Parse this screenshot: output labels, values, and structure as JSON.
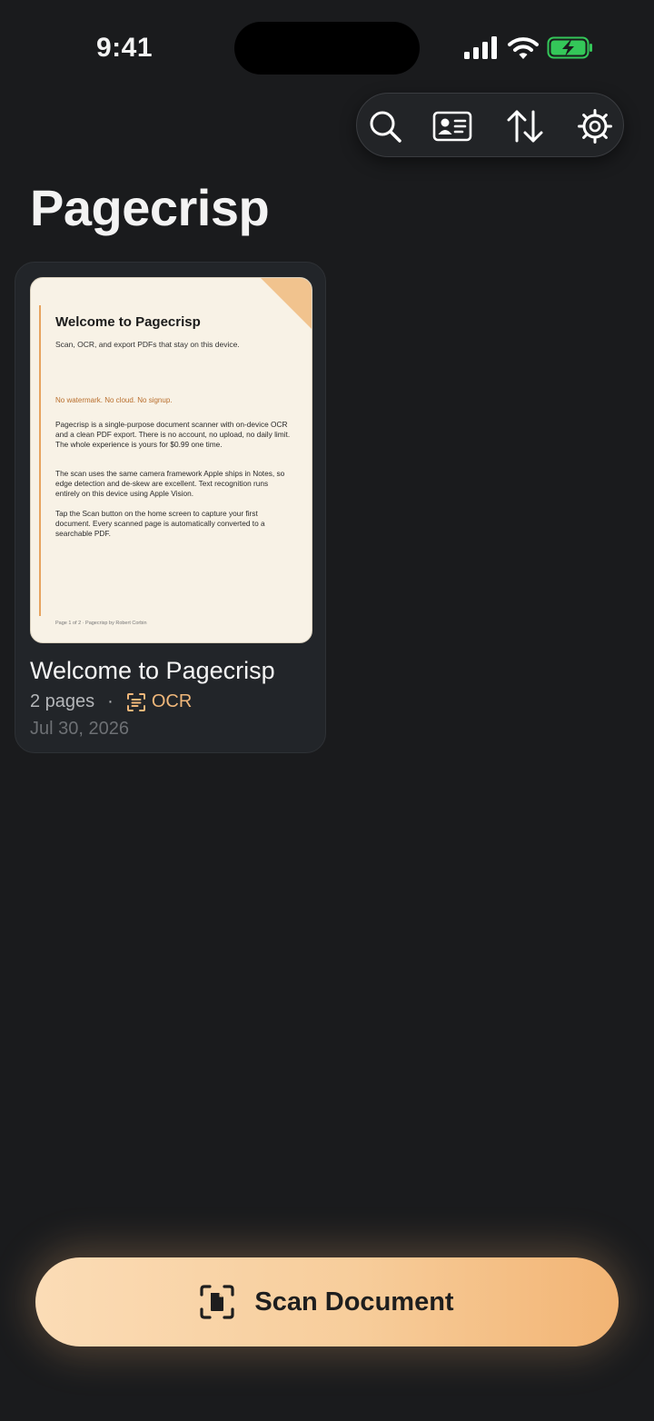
{
  "status_bar": {
    "time": "9:41"
  },
  "toolbar": {
    "search_icon": "search-icon",
    "contact_card_icon": "contact-card-icon",
    "sort_icon": "sort-icon",
    "settings_icon": "gear-icon"
  },
  "page": {
    "title": "Pagecrisp"
  },
  "documents": [
    {
      "thumbnail": {
        "title": "Welcome to Pagecrisp",
        "subtitle": "Scan, OCR, and export PDFs that stay on this device.",
        "tagline": "No watermark. No cloud. No signup.",
        "paragraphs": [
          "Pagecrisp is a single-purpose document scanner with on-device OCR and a clean PDF export. There is no account, no upload, no daily limit. The whole experience is yours for $0.99 one time.",
          "The scan uses the same camera framework Apple ships in Notes, so edge detection and de-skew are excellent. Text recognition runs entirely on this device using Apple Vision.",
          "Tap the Scan button on the home screen to capture your first document. Every scanned page is automatically converted to a searchable PDF."
        ],
        "footer": "Page 1 of 2 · Pagecrisp by Robert Corbin"
      },
      "title": "Welcome to Pagecrisp",
      "pages": "2 pages",
      "separator": "·",
      "ocr_label": "OCR",
      "date": "Jul 30, 2026"
    }
  ],
  "scan_button": {
    "label": "Scan Document",
    "icon": "document-scan-icon"
  },
  "colors": {
    "background": "#1a1b1d",
    "card": "#222529",
    "accent": "#f0b77a",
    "battery": "#34c759"
  }
}
